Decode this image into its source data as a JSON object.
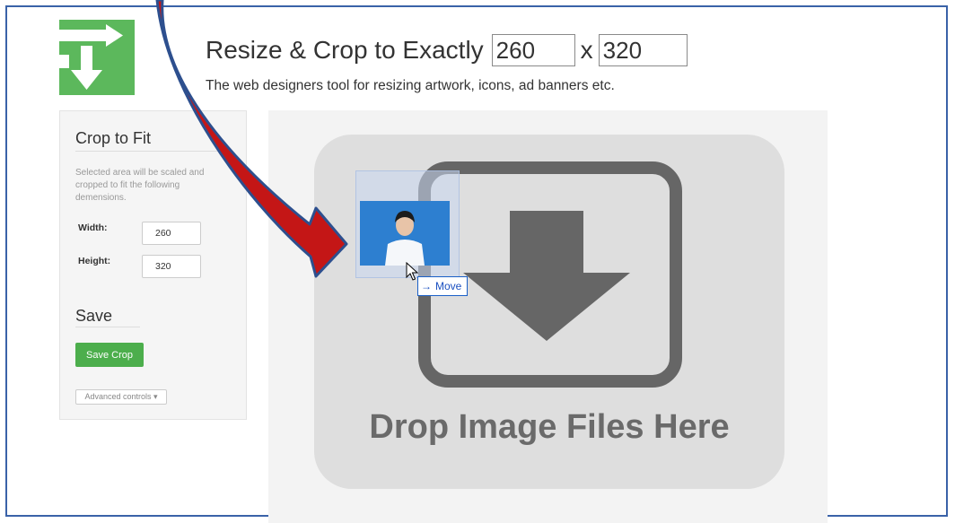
{
  "header": {
    "title": "Resize & Crop to Exactly",
    "width_value": "260",
    "separator": "x",
    "height_value": "320",
    "subtitle": "The web designers tool for resizing artwork, icons, ad banners etc."
  },
  "sidebar": {
    "crop_heading": "Crop to Fit",
    "description": "Selected area will be scaled and cropped to fit the following demensions.",
    "width_label": "Width:",
    "width_value": "260",
    "height_label": "Height:",
    "height_value": "320",
    "save_heading": "Save",
    "save_button": "Save Crop",
    "advanced_button": "Advanced controls ▾"
  },
  "dropzone": {
    "text": "Drop Image Files Here",
    "icon": "download-arrow-icon"
  },
  "drag": {
    "label": "Move",
    "label_icon": "arrow-right-icon"
  },
  "colors": {
    "brand_green": "#5cb85c",
    "save_button": "#4cae4c",
    "frame_border": "#3a62a8",
    "annotation_arrow": "#c41616"
  }
}
